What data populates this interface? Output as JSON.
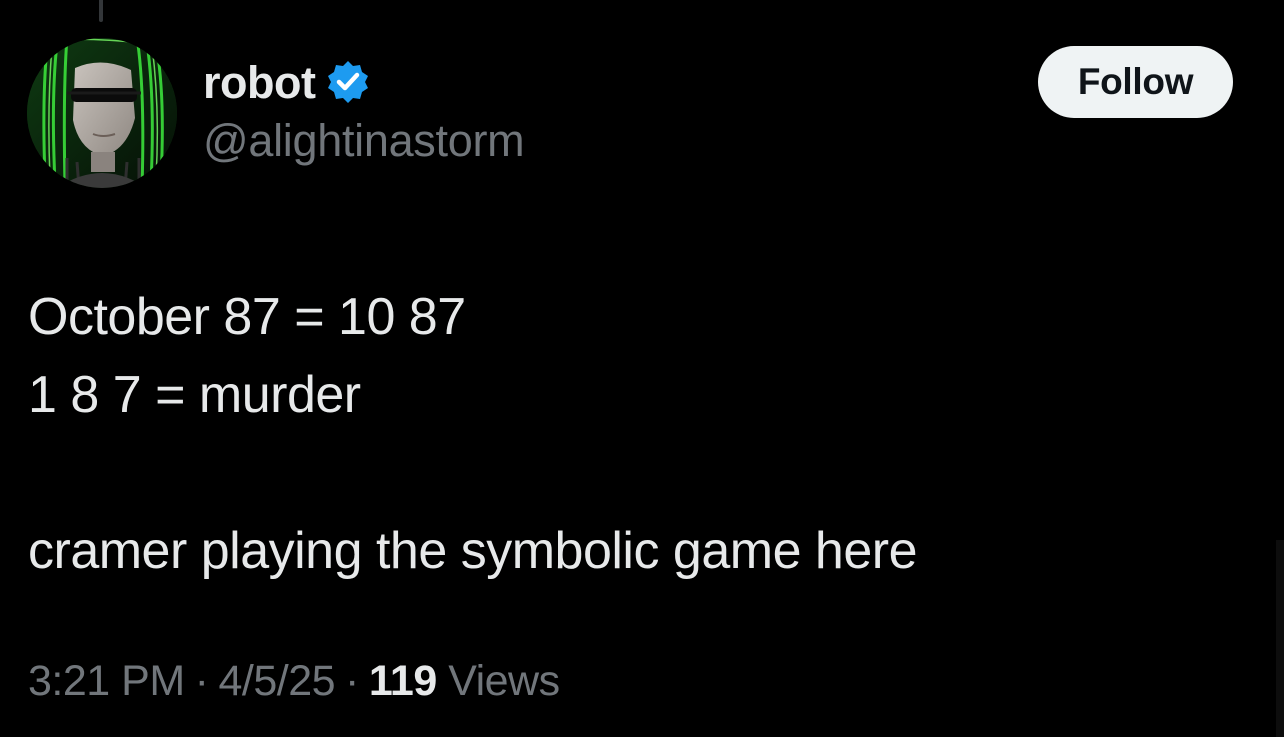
{
  "author": {
    "display_name": "robot",
    "handle": "@alightinastorm",
    "verified": true,
    "avatar_icon": "avatar-image"
  },
  "follow_button": {
    "label": "Follow"
  },
  "tweet": {
    "lines": [
      "October 87 = 10 87",
      "1 8 7 = murder",
      "",
      "cramer playing the symbolic game here"
    ]
  },
  "meta": {
    "time": "3:21 PM",
    "date": "4/5/25",
    "separator": "·",
    "views_count": "119",
    "views_label": "Views"
  },
  "colors": {
    "background": "#000000",
    "primary_text": "#e7e9ea",
    "secondary_text": "#71767b",
    "verified_blue": "#1d9bf0",
    "follow_bg": "#eff3f4"
  }
}
